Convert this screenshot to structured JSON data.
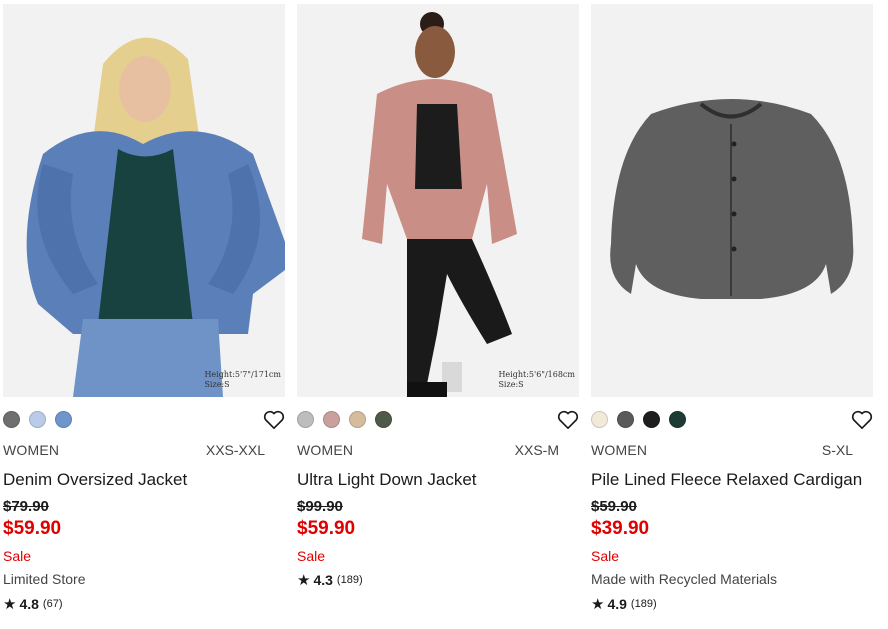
{
  "products": [
    {
      "model_note": [
        "Height:5'7\"/171cm",
        "Size:S"
      ],
      "swatches": [
        "#6f6f6f",
        "#b9cbe8",
        "#6f95cf"
      ],
      "gender": "WOMEN",
      "size_range": "XXS-XXL",
      "name": "Denim Oversized Jacket",
      "original_price": "$79.90",
      "sale_price": "$59.90",
      "sale_label": "Sale",
      "tag": "Limited Store",
      "rating": "4.8",
      "review_count": "(67)"
    },
    {
      "model_note": [
        "Height:5'6\"/168cm",
        "Size:S"
      ],
      "swatches": [
        "#bdbdbd",
        "#c9a09b",
        "#d4bc9c",
        "#4f5a48"
      ],
      "gender": "WOMEN",
      "size_range": "XXS-M",
      "name": "Ultra Light Down Jacket",
      "original_price": "$99.90",
      "sale_price": "$59.90",
      "sale_label": "Sale",
      "tag": "",
      "rating": "4.3",
      "review_count": "(189)"
    },
    {
      "model_note": [
        "",
        ""
      ],
      "swatches": [
        "#f1ead9",
        "#5a5a5a",
        "#1e1e1e",
        "#1d3a35"
      ],
      "gender": "WOMEN",
      "size_range": "S-XL",
      "name": "Pile Lined Fleece Relaxed Cardigan",
      "original_price": "$59.90",
      "sale_price": "$39.90",
      "sale_label": "Sale",
      "tag": "Made with Recycled Materials",
      "rating": "4.9",
      "review_count": "(189)"
    }
  ],
  "icons": {
    "favorite": "heart-outline-icon",
    "star": "star-icon"
  },
  "colors": {
    "sale_red": "#e00000",
    "text": "#1b1b1b"
  }
}
